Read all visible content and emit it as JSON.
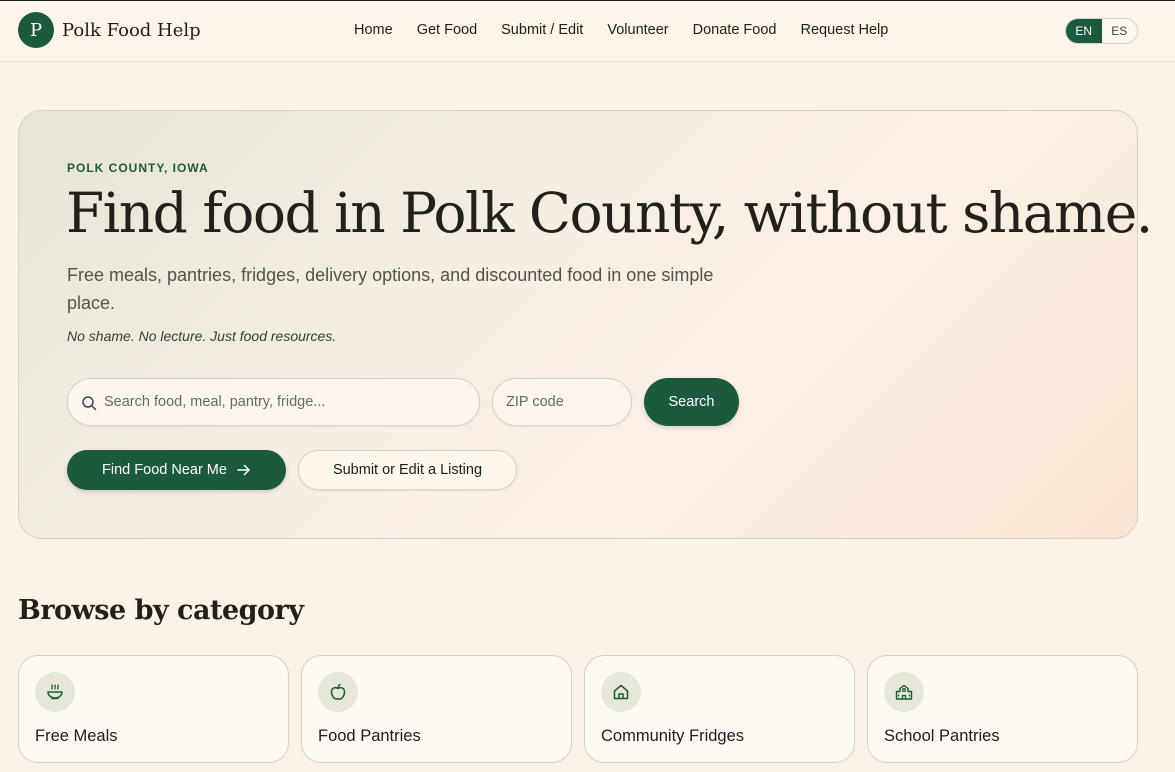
{
  "header": {
    "logo_letter": "P",
    "site_name": "Polk Food Help",
    "nav": [
      "Home",
      "Get Food",
      "Submit / Edit",
      "Volunteer",
      "Donate Food",
      "Request Help"
    ],
    "languages": [
      "EN",
      "ES"
    ],
    "active_language": "EN"
  },
  "hero": {
    "eyebrow": "POLK COUNTY, IOWA",
    "title": "Find food in Polk County, without shame.",
    "lede": "Free meals, pantries, fridges, delivery options, and discounted food in one simple place.",
    "tagline": "No shame. No lecture. Just food resources.",
    "search_placeholder": "Search food, meal, pantry, fridge...",
    "zip_placeholder": "ZIP code",
    "search_button": "Search",
    "find_button": "Find Food Near Me",
    "submit_button": "Submit or Edit a Listing"
  },
  "categories": {
    "title": "Browse by category",
    "items": [
      {
        "label": "Free Meals",
        "icon": "bowl-icon"
      },
      {
        "label": "Food Pantries",
        "icon": "apple-icon"
      },
      {
        "label": "Community Fridges",
        "icon": "home-icon"
      },
      {
        "label": "School Pantries",
        "icon": "school-icon"
      }
    ]
  },
  "colors": {
    "brand": "#1b5a3c",
    "background": "#fcf3e7"
  }
}
